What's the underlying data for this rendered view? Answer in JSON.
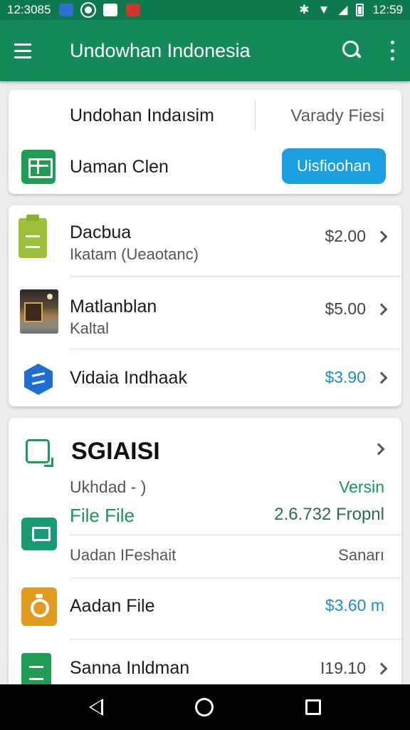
{
  "status_bar": {
    "time_left": "12:3085",
    "time_right": "12:59",
    "icons": [
      "app-blue-icon",
      "circle-icon",
      "cat-icon",
      "red-app-icon",
      "bluetooth-icon",
      "wifi-icon",
      "signal-icon",
      "battery-icon"
    ]
  },
  "app_bar": {
    "title": "Undowhan Indonesia",
    "color": "#138a5a",
    "icons": [
      "menu-icon",
      "search-icon",
      "more-vert-icon"
    ]
  },
  "card1": {
    "title": "Undohan Indaısim",
    "right_text": "Varady Fiesi",
    "row_label": "Uaman Clen",
    "button_label": "Uisfioohan",
    "button_color": "#1aa0e0"
  },
  "card2": {
    "rows": [
      {
        "name": "Dacbua",
        "sub": "Ikatam (Ueaotanc)",
        "price": "$2.00",
        "icon": "clipboard-icon"
      },
      {
        "name": "Matlanblan",
        "sub": "Kaltal",
        "price": "$5.00",
        "icon": "photo-thumbnail"
      },
      {
        "name": "Vidaia Indhaak",
        "sub": "",
        "price": "$3.90",
        "icon": "hex-app-icon"
      }
    ]
  },
  "card3": {
    "title": "SGIAISI",
    "sub_left": "Ukhdad - )",
    "sub_right": "Versin",
    "file_left": "File File",
    "file_right": "2.6.732 Fropnl",
    "row4_left": "Uadan IFeshait",
    "row4_right": "Sanarı",
    "row5_left": "Aadan File",
    "row5_right": "$3.60 m",
    "row6_left": "Sanna Inldman",
    "row6_right": "I19.10"
  },
  "colors": {
    "green_accent": "#179658",
    "blue_accent": "#1b8ec2"
  }
}
